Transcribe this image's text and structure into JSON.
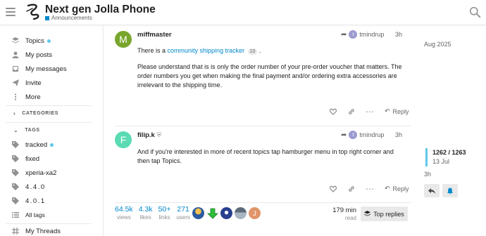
{
  "header": {
    "title": "Next gen Jolla Phone",
    "category": "Announcements",
    "category_color": "#0088cc"
  },
  "sidebar": {
    "items": [
      {
        "label": "Topics",
        "icon": "layers-icon",
        "dot": true
      },
      {
        "label": "My posts",
        "icon": "user-icon"
      },
      {
        "label": "My messages",
        "icon": "inbox-icon"
      },
      {
        "label": "Invite",
        "icon": "paper-plane-icon"
      },
      {
        "label": "More",
        "icon": "vertical-ellipsis-icon"
      }
    ],
    "categories_header": "CATEGORIES",
    "tags_header": "TAGS",
    "tags": [
      {
        "label": "tracked",
        "dot": true
      },
      {
        "label": "fixed"
      },
      {
        "label": "xperia-xa2"
      },
      {
        "label": "4.4.0"
      },
      {
        "label": "4.0.1"
      }
    ],
    "all_tags": "All tags",
    "my_threads": "My Threads"
  },
  "posts": [
    {
      "avatar_letter": "M",
      "avatar_color": "#78a62c",
      "username": "miffmaster",
      "reply_to_letter": "t",
      "reply_to_user": "tmindrup",
      "time": "3h",
      "p1_before": "There is a ",
      "p1_link": "community shipping tracker",
      "p1_clicks": "10",
      "p1_after": " .",
      "p2": "Please understand that is is only the order number of your pre-order voucher that matters. The order numbers you get when making the final payment and/or ordering extra accessories are irrelevant to the shipping time.",
      "reply_label": "Reply"
    },
    {
      "avatar_letter": "F",
      "avatar_color": "#5bdbb3",
      "username": "filip.k",
      "reply_to_letter": "t",
      "reply_to_user": "tmindrup",
      "time": "3h",
      "p1": "And if you're interested in more of recent topics tap hamburger menu in top right corner and then tap Topics.",
      "reply_label": "Reply"
    }
  ],
  "stats": [
    {
      "num": "64.5k",
      "label": "views"
    },
    {
      "num": "4.3k",
      "label": "likes"
    },
    {
      "num": "50+",
      "label": "links"
    },
    {
      "num": "271",
      "label": "users"
    }
  ],
  "participant_letter": "J",
  "read_time": {
    "num": "179 min",
    "label": "read"
  },
  "top_replies": "Top replies",
  "timeline": {
    "top_date": "Aug 2025",
    "position": "1262 / 1263",
    "date": "13 Jul",
    "bottom": "3h"
  }
}
